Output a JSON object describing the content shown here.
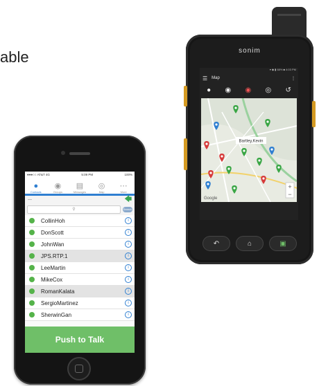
{
  "caption": "able",
  "iphone": {
    "status": {
      "left": "●●●○○ AT&T 4G",
      "time": "5:09 PM",
      "right": "100%"
    },
    "tabs": [
      {
        "label": "Contacts",
        "icon": "person-icon",
        "active": true
      },
      {
        "label": "Groups",
        "icon": "group-icon",
        "active": false
      },
      {
        "label": "Messages",
        "icon": "chat-icon",
        "active": false
      },
      {
        "label": "Map",
        "icon": "globe-icon",
        "active": false
      },
      {
        "label": "More",
        "icon": "more-icon",
        "active": false
      }
    ],
    "subbar_left": "—",
    "search_placeholder": "",
    "search_button": "Search",
    "contacts": [
      {
        "name": "CollinHoh",
        "highlight": false
      },
      {
        "name": "DonScott",
        "highlight": false
      },
      {
        "name": "JohnWan",
        "highlight": false
      },
      {
        "name": "JPS.RTP.1",
        "highlight": true
      },
      {
        "name": "LeeMartin",
        "highlight": false
      },
      {
        "name": "MikeCox",
        "highlight": false
      },
      {
        "name": "RomanKalata",
        "highlight": true
      },
      {
        "name": "SergioMartinez",
        "highlight": false
      },
      {
        "name": "SherwinGan",
        "highlight": false
      }
    ],
    "ptt_label": "Push to Talk",
    "colors": {
      "accent": "#2f7fd1",
      "online": "#55b34a",
      "ptt": "#6fbf68"
    }
  },
  "sonim": {
    "brand": "sonim",
    "status": "▾ ◆ ▮ 68% ■ 4:03 PM",
    "appbar_title": "Map",
    "map": {
      "label": "Bartley,Kevin",
      "pins": [
        {
          "color": "#3aa645"
        },
        {
          "color": "#2f7fd1"
        },
        {
          "color": "#3aa645"
        },
        {
          "color": "#d63b3b"
        },
        {
          "color": "#3aa645"
        },
        {
          "color": "#2f7fd1"
        },
        {
          "color": "#d63b3b"
        },
        {
          "color": "#3aa645"
        },
        {
          "color": "#3aa645"
        },
        {
          "color": "#d63b3b"
        },
        {
          "color": "#3aa645"
        },
        {
          "color": "#2f7fd1"
        },
        {
          "color": "#3aa645"
        },
        {
          "color": "#d63b3b"
        }
      ],
      "zoom_in": "+",
      "zoom_out": "−",
      "attribution": "Google"
    },
    "toolbar_icons": [
      "person-icon",
      "location-person-icon",
      "group-chat-icon",
      "target-icon",
      "history-icon"
    ]
  }
}
